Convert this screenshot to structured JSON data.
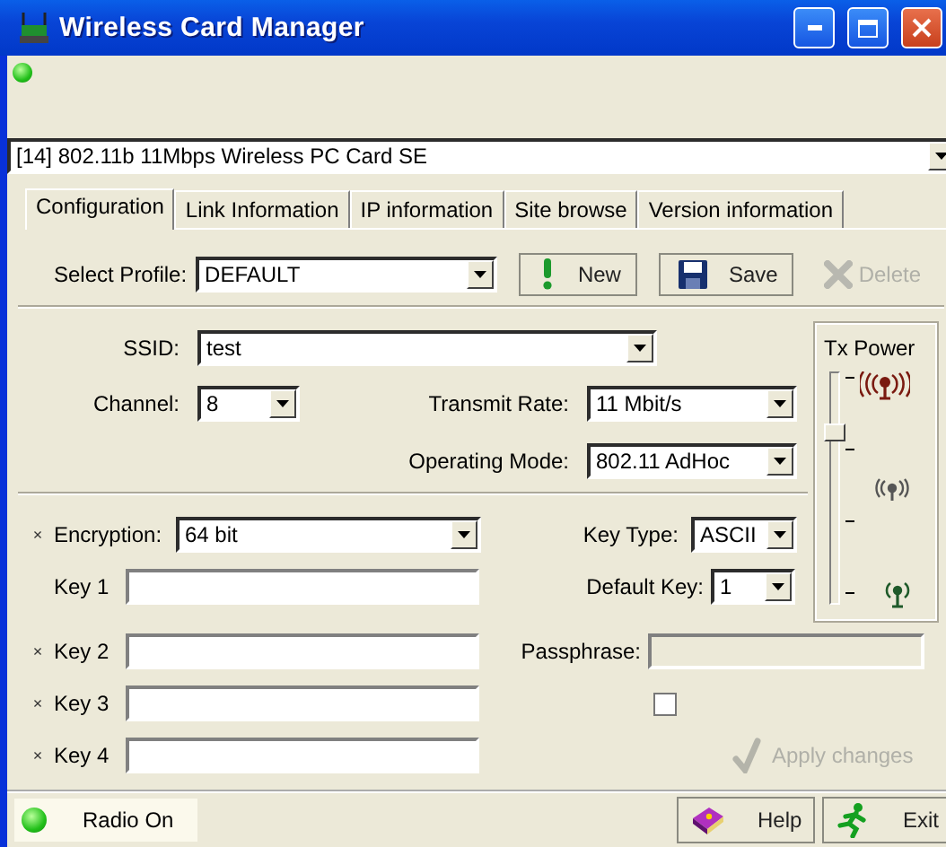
{
  "window": {
    "title": "Wireless Card Manager"
  },
  "device": {
    "value": "[14] 802.11b 11Mbps Wireless PC Card SE"
  },
  "tabs": [
    {
      "label": "Configuration",
      "selected": true
    },
    {
      "label": "Link Information",
      "selected": false
    },
    {
      "label": "IP information",
      "selected": false
    },
    {
      "label": "Site browse",
      "selected": false
    },
    {
      "label": "Version information",
      "selected": false
    }
  ],
  "profile": {
    "label": "Select Profile:",
    "value": "DEFAULT"
  },
  "profile_buttons": [
    {
      "label": "New",
      "kind": "new",
      "disabled": false
    },
    {
      "label": "Save",
      "kind": "save",
      "disabled": false
    },
    {
      "label": "Delete",
      "kind": "delete",
      "disabled": true
    }
  ],
  "ssid": {
    "label": "SSID:",
    "value": "test"
  },
  "channel": {
    "label": "Channel:",
    "value": "8"
  },
  "transmit_rate": {
    "label": "Transmit Rate:",
    "value": "11 Mbit/s"
  },
  "operating_mode": {
    "label": "Operating Mode:",
    "value": "802.11 AdHoc"
  },
  "tx_power": {
    "title": "Tx Power",
    "level": 0.75
  },
  "encryption": {
    "mark": "×",
    "label": "Encryption:",
    "value": "64 bit"
  },
  "key_type": {
    "label": "Key Type:",
    "value": "ASCII"
  },
  "default_key": {
    "label": "Default Key:",
    "value": "1"
  },
  "keys": [
    {
      "label": "Key 1"
    },
    {
      "mark": "×",
      "label": "Key 2"
    },
    {
      "mark": "×",
      "label": "Key 3"
    },
    {
      "mark": "×",
      "label": "Key 4"
    }
  ],
  "passphrase": {
    "label": "Passphrase:",
    "disabled": true
  },
  "passphrase_checkbox": {
    "checked": false
  },
  "apply": {
    "label": "Apply changes",
    "disabled": true
  },
  "radio": {
    "label": "Radio On",
    "on": true
  },
  "bottom_buttons": [
    {
      "label": "Help",
      "kind": "help"
    },
    {
      "label": "Exit",
      "kind": "exit"
    }
  ]
}
